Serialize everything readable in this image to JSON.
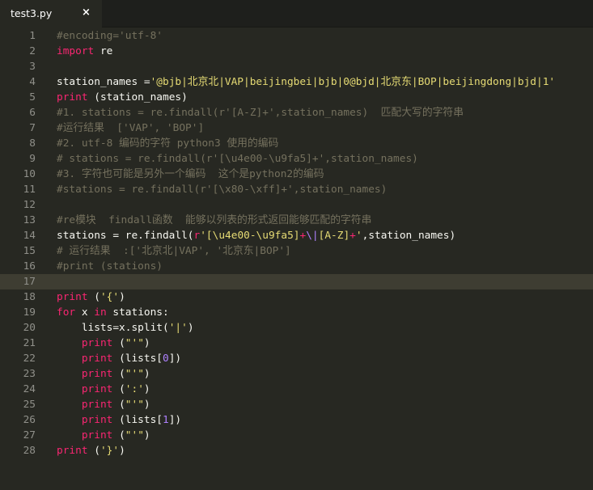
{
  "tab": {
    "title": "test3.py",
    "close_symbol": "×"
  },
  "theme": {
    "background": "#272822",
    "comment": "#75715e",
    "keyword": "#f92672",
    "builtin": "#66d9ef",
    "string": "#e6db74",
    "number": "#ae81ff"
  },
  "lines": [
    {
      "n": "1",
      "tokens": [
        {
          "c": "comment",
          "t": "#encoding='utf-8'"
        }
      ]
    },
    {
      "n": "2",
      "tokens": [
        {
          "c": "keyword",
          "t": "import"
        },
        {
          "c": "plain",
          "t": " re"
        }
      ]
    },
    {
      "n": "3",
      "tokens": []
    },
    {
      "n": "4",
      "tokens": [
        {
          "c": "plain",
          "t": "station_names ="
        },
        {
          "c": "string",
          "t": "'@bjb|北京北|VAP|beijingbei|bjb|0@bjd|北京东|BOP|beijingdong|bjd|1'"
        }
      ]
    },
    {
      "n": "5",
      "tokens": [
        {
          "c": "keyword",
          "t": "print"
        },
        {
          "c": "plain",
          "t": " (station_names)"
        }
      ]
    },
    {
      "n": "6",
      "tokens": [
        {
          "c": "comment",
          "t": "#1. stations = re.findall(r'[A-Z]+',station_names)  匹配大写的字符串"
        }
      ]
    },
    {
      "n": "7",
      "tokens": [
        {
          "c": "comment",
          "t": "#运行结果  ['VAP', 'BOP']"
        }
      ]
    },
    {
      "n": "8",
      "tokens": [
        {
          "c": "comment",
          "t": "#2. utf-8 编码的字符 python3 使用的编码"
        }
      ]
    },
    {
      "n": "9",
      "tokens": [
        {
          "c": "comment",
          "t": "# stations = re.findall(r'[\\u4e00-\\u9fa5]+',station_names)"
        }
      ]
    },
    {
      "n": "10",
      "tokens": [
        {
          "c": "comment",
          "t": "#3. 字符也可能是另外一个编码  这个是python2的编码"
        }
      ]
    },
    {
      "n": "11",
      "tokens": [
        {
          "c": "comment",
          "t": "#stations = re.findall(r'[\\x80-\\xff]+',station_names)"
        }
      ]
    },
    {
      "n": "12",
      "tokens": []
    },
    {
      "n": "13",
      "tokens": [
        {
          "c": "comment",
          "t": "#re模块  findall函数  能够以列表的形式返回能够匹配的字符串"
        }
      ]
    },
    {
      "n": "14",
      "tokens": [
        {
          "c": "plain",
          "t": "stations = re.findall("
        },
        {
          "c": "keyword",
          "t": "r"
        },
        {
          "c": "string",
          "t": "'[\\u4e00-\\u9fa5]"
        },
        {
          "c": "op",
          "t": "+"
        },
        {
          "c": "escape",
          "t": "\\|"
        },
        {
          "c": "string",
          "t": "[A-Z]"
        },
        {
          "c": "op",
          "t": "+"
        },
        {
          "c": "string",
          "t": "'"
        },
        {
          "c": "plain",
          "t": ",station_names)"
        }
      ]
    },
    {
      "n": "15",
      "tokens": [
        {
          "c": "comment",
          "t": "# 运行结果  :['北京北|VAP', '北京东|BOP']"
        }
      ]
    },
    {
      "n": "16",
      "tokens": [
        {
          "c": "comment",
          "t": "#print (stations)"
        }
      ]
    },
    {
      "n": "17",
      "tokens": [],
      "active": true
    },
    {
      "n": "18",
      "tokens": [
        {
          "c": "keyword",
          "t": "print"
        },
        {
          "c": "plain",
          "t": " ("
        },
        {
          "c": "string",
          "t": "'{'"
        },
        {
          "c": "plain",
          "t": ")"
        }
      ]
    },
    {
      "n": "19",
      "tokens": [
        {
          "c": "keyword",
          "t": "for"
        },
        {
          "c": "plain",
          "t": " x "
        },
        {
          "c": "keyword",
          "t": "in"
        },
        {
          "c": "plain",
          "t": " stations:"
        }
      ]
    },
    {
      "n": "20",
      "tokens": [
        {
          "c": "plain",
          "t": "    lists=x.split("
        },
        {
          "c": "string",
          "t": "'|'"
        },
        {
          "c": "plain",
          "t": ")"
        }
      ]
    },
    {
      "n": "21",
      "tokens": [
        {
          "c": "plain",
          "t": "    "
        },
        {
          "c": "keyword",
          "t": "print"
        },
        {
          "c": "plain",
          "t": " ("
        },
        {
          "c": "string",
          "t": "\"'\""
        },
        {
          "c": "plain",
          "t": ")"
        }
      ]
    },
    {
      "n": "22",
      "tokens": [
        {
          "c": "plain",
          "t": "    "
        },
        {
          "c": "keyword",
          "t": "print"
        },
        {
          "c": "plain",
          "t": " (lists["
        },
        {
          "c": "number",
          "t": "0"
        },
        {
          "c": "plain",
          "t": "])"
        }
      ]
    },
    {
      "n": "23",
      "tokens": [
        {
          "c": "plain",
          "t": "    "
        },
        {
          "c": "keyword",
          "t": "print"
        },
        {
          "c": "plain",
          "t": " ("
        },
        {
          "c": "string",
          "t": "\"'\""
        },
        {
          "c": "plain",
          "t": ")"
        }
      ]
    },
    {
      "n": "24",
      "tokens": [
        {
          "c": "plain",
          "t": "    "
        },
        {
          "c": "keyword",
          "t": "print"
        },
        {
          "c": "plain",
          "t": " ("
        },
        {
          "c": "string",
          "t": "':'"
        },
        {
          "c": "plain",
          "t": ")"
        }
      ]
    },
    {
      "n": "25",
      "tokens": [
        {
          "c": "plain",
          "t": "    "
        },
        {
          "c": "keyword",
          "t": "print"
        },
        {
          "c": "plain",
          "t": " ("
        },
        {
          "c": "string",
          "t": "\"'\""
        },
        {
          "c": "plain",
          "t": ")"
        }
      ]
    },
    {
      "n": "26",
      "tokens": [
        {
          "c": "plain",
          "t": "    "
        },
        {
          "c": "keyword",
          "t": "print"
        },
        {
          "c": "plain",
          "t": " (lists["
        },
        {
          "c": "number",
          "t": "1"
        },
        {
          "c": "plain",
          "t": "])"
        }
      ]
    },
    {
      "n": "27",
      "tokens": [
        {
          "c": "plain",
          "t": "    "
        },
        {
          "c": "keyword",
          "t": "print"
        },
        {
          "c": "plain",
          "t": " ("
        },
        {
          "c": "string",
          "t": "\"'\""
        },
        {
          "c": "plain",
          "t": ")"
        }
      ]
    },
    {
      "n": "28",
      "tokens": [
        {
          "c": "keyword",
          "t": "print"
        },
        {
          "c": "plain",
          "t": " ("
        },
        {
          "c": "string",
          "t": "'}'"
        },
        {
          "c": "plain",
          "t": ")"
        }
      ]
    }
  ]
}
